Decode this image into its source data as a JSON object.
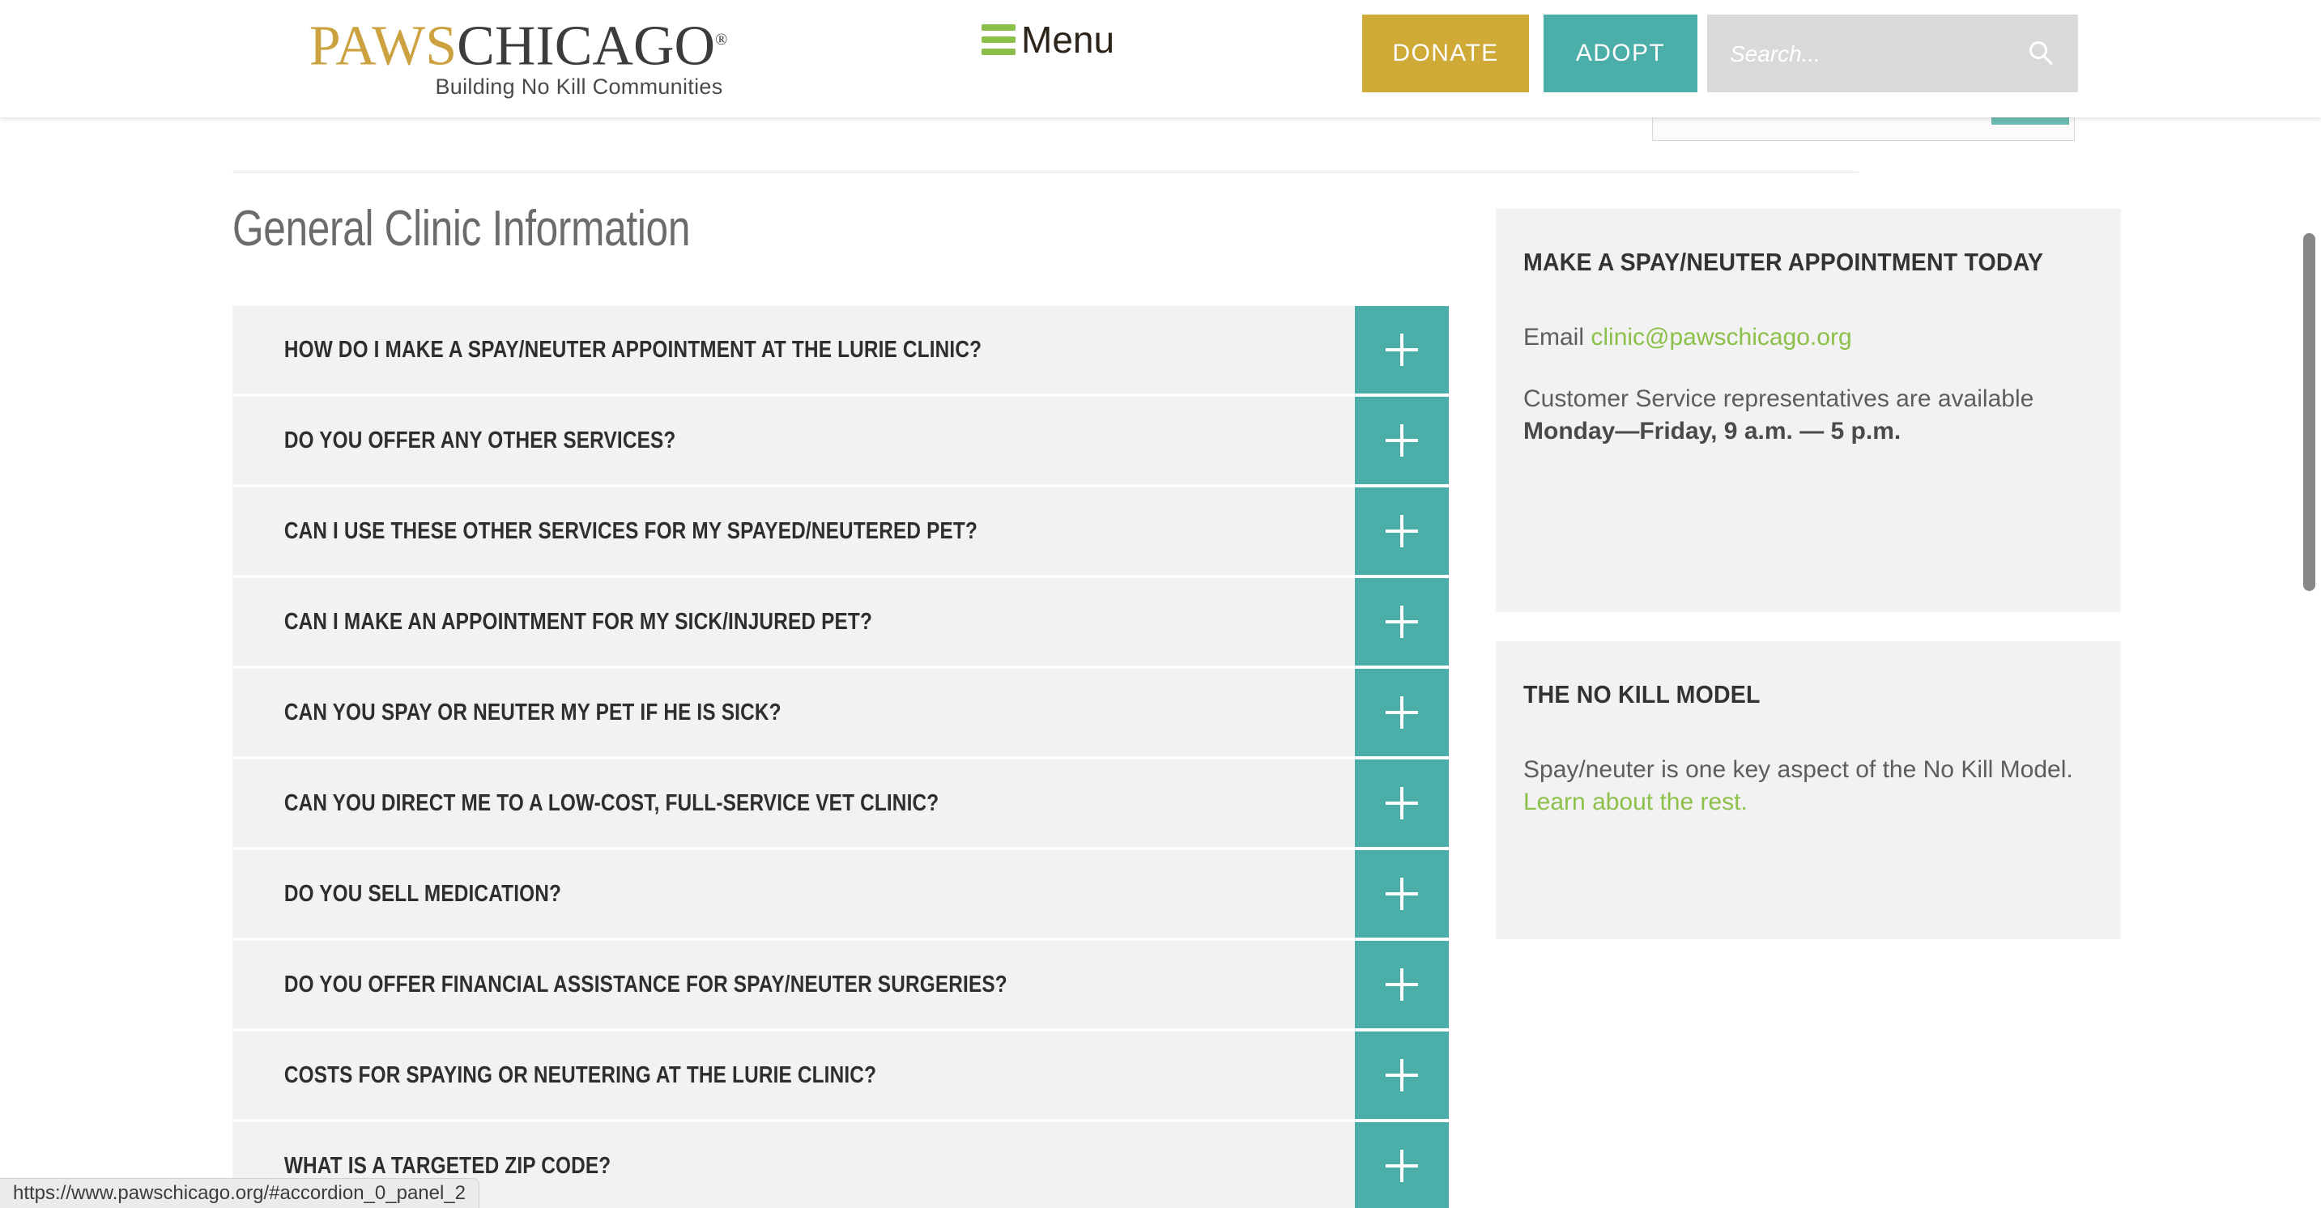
{
  "header": {
    "logo": {
      "paws": "PAWS",
      "chicago": "CHICAGO",
      "registered": "®",
      "tagline": "Building No Kill Communities"
    },
    "menu_label": "Menu",
    "donate_label": "DONATE",
    "adopt_label": "ADOPT",
    "search_placeholder": "Search...",
    "search_value": ""
  },
  "main": {
    "page_title": "General Clinic Information",
    "accordion_items": [
      {
        "label": "HOW DO I MAKE A SPAY/NEUTER APPOINTMENT AT THE LURIE CLINIC?",
        "toggle": "+"
      },
      {
        "label": "DO YOU OFFER ANY OTHER SERVICES?",
        "toggle": "+"
      },
      {
        "label": "CAN I USE THESE OTHER SERVICES FOR MY SPAYED/NEUTERED PET?",
        "toggle": "+"
      },
      {
        "label": "CAN I MAKE AN APPOINTMENT FOR MY SICK/INJURED PET?",
        "toggle": "+"
      },
      {
        "label": "CAN YOU SPAY OR NEUTER MY PET IF HE IS SICK?",
        "toggle": "+"
      },
      {
        "label": "CAN YOU DIRECT ME TO A LOW-COST, FULL-SERVICE VET CLINIC?",
        "toggle": "+"
      },
      {
        "label": "DO YOU SELL MEDICATION?",
        "toggle": "+"
      },
      {
        "label": "DO YOU OFFER FINANCIAL ASSISTANCE FOR SPAY/NEUTER SURGERIES?",
        "toggle": "+"
      },
      {
        "label": "COSTS FOR SPAYING OR NEUTERING AT THE LURIE CLINIC?",
        "toggle": "+"
      },
      {
        "label": "WHAT IS A TARGETED ZIP CODE?",
        "toggle": "+"
      }
    ]
  },
  "sidebar": {
    "appointment_card": {
      "title": "MAKE A SPAY/NEUTER APPOINTMENT TODAY",
      "email_prefix": "Email ",
      "email_link": "clinic@pawschicago.org",
      "hours_prefix": "Customer Service representatives are available ",
      "hours_value": "Monday—Friday, 9 a.m. — 5 p.m."
    },
    "nokill_card": {
      "title": "THE NO KILL MODEL",
      "body_prefix": "Spay/neuter is one key aspect of the No Kill Model. ",
      "body_link": "Learn about the rest."
    }
  },
  "status_bar": {
    "url": "https://www.pawschicago.org/#accordion_0_panel_2"
  },
  "colors": {
    "gold": "#CFAA36",
    "teal": "#4BAEA9",
    "green": "#8CC04A",
    "row_bg": "#f2f2f2",
    "search_bg": "#D9D9D9"
  }
}
